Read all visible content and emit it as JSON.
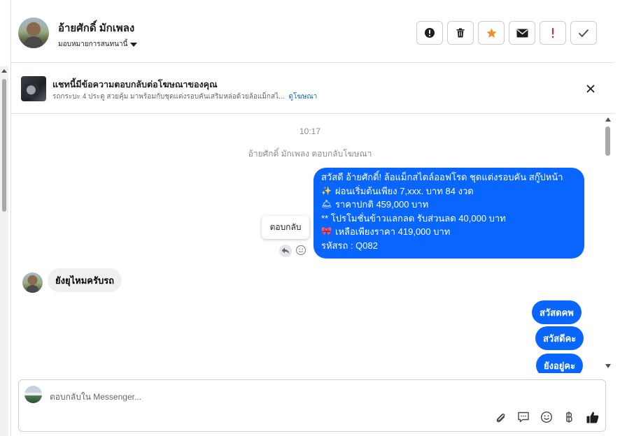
{
  "header": {
    "contact_name": "อ้ายศักดิ์ มักเพลง",
    "assign_label": "มอบหมายการสนทนานี้"
  },
  "ad_banner": {
    "title": "แชทนี้มีข้อความตอบกลับต่อโฆษณาของคุณ",
    "subtitle": "รถกระบะ 4 ประตู สวยคุ้ม มาพร้อมกับชุดแต่งรอบคันเสริมหล่อด้วยล้อแม็กสไ...",
    "link": "ดูโฆษณา"
  },
  "chat": {
    "time": "10:17",
    "system_message": "อ้ายศักดิ์ มักเพลง ตอบกลับโฆษณา",
    "ad_message_lines": [
      {
        "emoji": "",
        "text": "สวัสดี อ้ายศักดิ์! ล้อแม็กสไตล์ออฟโรด ชุดแต่งรอบคัน สกู๊ปหน้า"
      },
      {
        "emoji": "✨",
        "text": "ผ่อนเริ่มต้นเพียง 7,xxx. บาท 84 งวด"
      },
      {
        "emoji": "🛎",
        "text": "ราคาปกติ 459,000 บาท"
      },
      {
        "emoji": "",
        "text": "** โปรโมชั่นข้าวแลกลด รับส่วนลด 40,000 บาท"
      },
      {
        "emoji": "🎀",
        "text": "เหลือเพียงราคา 419,000 บาท"
      },
      {
        "emoji": "",
        "text": "รหัสรถ : Q082"
      }
    ],
    "reply_tooltip": "ตอบกลับ",
    "incoming_message": "ยังยุไหมครับรถ",
    "outgoing_messages": [
      "สวัสดคพ",
      "สวัสดีคะ",
      "ยังอยู่คะ"
    ]
  },
  "composer": {
    "placeholder": "ตอบกลับใน Messenger..."
  },
  "colors": {
    "bubble_blue": "#0866ff",
    "accent_star": "#f28c28",
    "accent_red": "#e41e3f"
  }
}
